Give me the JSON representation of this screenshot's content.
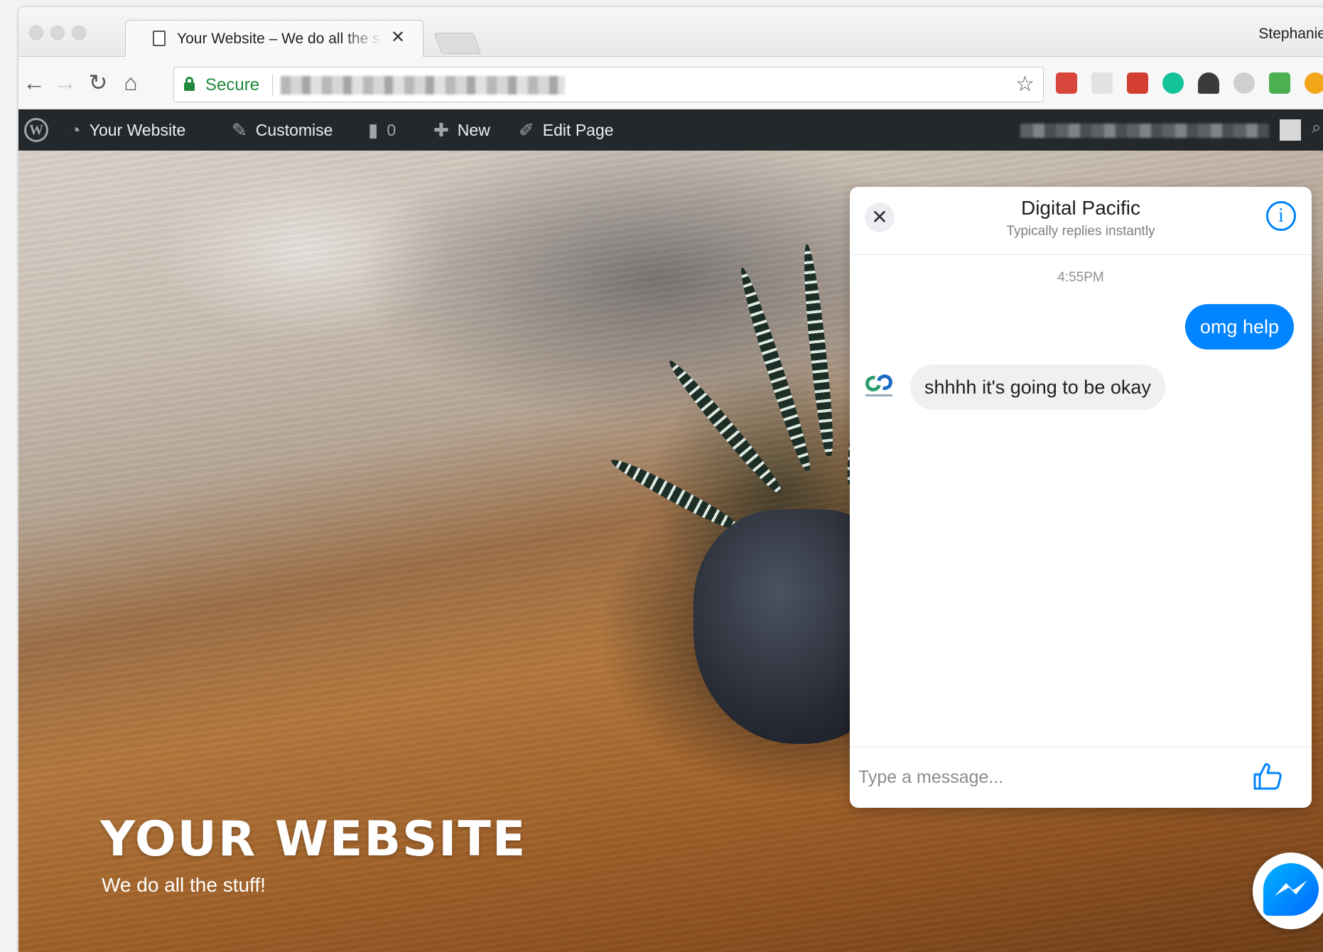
{
  "browser": {
    "tab_title": "Your Website – We do all the stuff!",
    "tab_close": "✕",
    "profile_name": "Stephanie",
    "secure_label": "Secure",
    "nav": {
      "back": "←",
      "forward": "→",
      "reload": "↻",
      "home": "⌂"
    },
    "bookmark_star": "☆"
  },
  "admin_bar": {
    "site_name": "Your Website",
    "customise": "Customise",
    "comments_count": "0",
    "new_label": "New",
    "edit_page": "Edit Page"
  },
  "hero": {
    "title": "YOUR WEBSITE",
    "tagline": "We do all the stuff!"
  },
  "chat": {
    "page_name": "Digital Pacific",
    "response_time": "Typically replies instantly",
    "timestamp": "4:55PM",
    "messages": [
      {
        "from": "user",
        "text": "omg help"
      },
      {
        "from": "page",
        "text": "shhhh it's going to be okay"
      }
    ],
    "input_placeholder": "Type a message...",
    "close_glyph": "✕",
    "info_glyph": "i"
  },
  "colors": {
    "messenger_blue": "#0084ff",
    "admin_bar": "#23282d",
    "secure_green": "#1f8a3b"
  },
  "icons": [
    "file-icon",
    "lock-icon",
    "star-icon",
    "wordpress-logo-icon",
    "dashboard-icon",
    "brush-icon",
    "comment-icon",
    "plus-icon",
    "pencil-icon",
    "close-icon",
    "info-icon",
    "thumbs-up-icon",
    "messenger-icon"
  ]
}
